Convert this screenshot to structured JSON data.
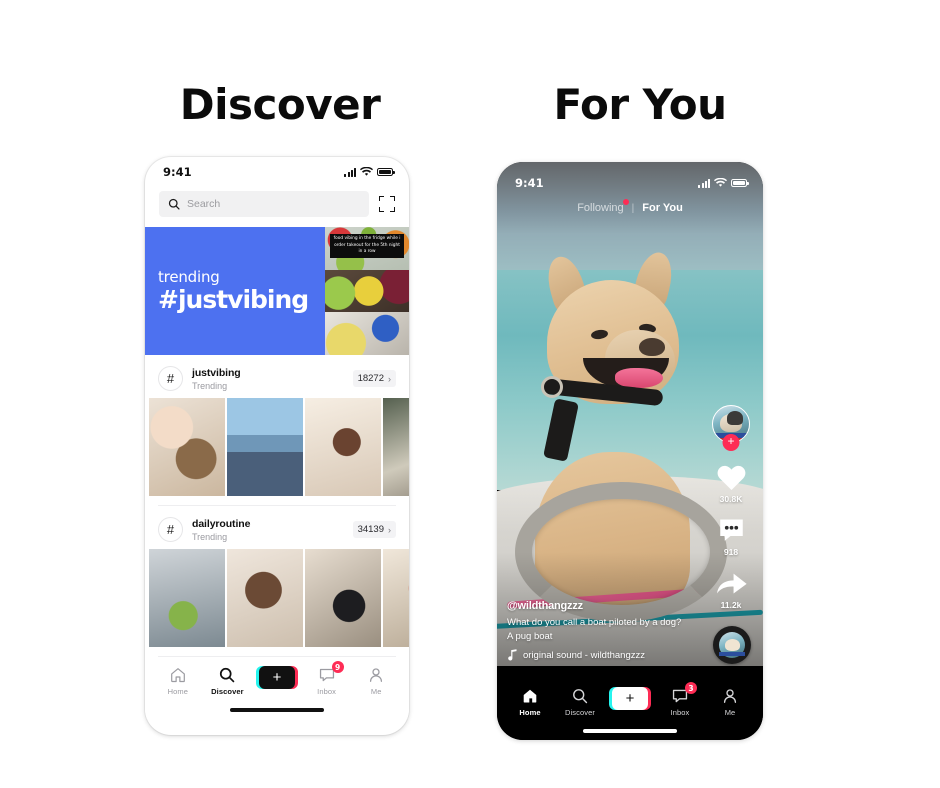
{
  "page": {
    "headings": {
      "left": "Discover",
      "right": "For You"
    }
  },
  "colors": {
    "accent_pink": "#fe2c55",
    "accent_cyan": "#25f4ee",
    "banner_blue": "#4d71f0",
    "badge_red": "#fe2c55"
  },
  "left_phone": {
    "status_bar": {
      "time": "9:41",
      "icons": [
        "signal-bars-icon",
        "wifi-icon",
        "battery-icon"
      ]
    },
    "search": {
      "placeholder": "Search",
      "icon": "search-icon",
      "scan_icon": "scan-code-icon"
    },
    "banner": {
      "label": "trending",
      "hashtag": "#justvibing",
      "thumbnail_caption": "food vibing in the fridge while i order takeout for the 5th night in a row"
    },
    "hashtags": [
      {
        "symbol": "#",
        "name": "justvibing",
        "subtitle": "Trending",
        "count": "18272",
        "chevron": "›"
      },
      {
        "symbol": "#",
        "name": "dailyroutine",
        "subtitle": "Trending",
        "count": "34139",
        "chevron": "›"
      }
    ],
    "nav": {
      "items": [
        {
          "label": "Home",
          "icon": "home-icon",
          "active": false,
          "badge": ""
        },
        {
          "label": "Discover",
          "icon": "search-icon",
          "active": true,
          "badge": ""
        },
        {
          "label": "",
          "icon": "create-plus-icon",
          "active": false,
          "badge": ""
        },
        {
          "label": "Inbox",
          "icon": "inbox-message-icon",
          "active": false,
          "badge": "9"
        },
        {
          "label": "Me",
          "icon": "person-icon",
          "active": false,
          "badge": ""
        }
      ],
      "plus_glyph": "+"
    }
  },
  "right_phone": {
    "status_bar": {
      "time": "9:41",
      "icons": [
        "signal-bars-icon",
        "wifi-icon",
        "battery-icon"
      ]
    },
    "feed_tabs": {
      "following": "Following",
      "separator": "|",
      "for_you": "For You",
      "active": "For You",
      "has_notification_dot": true
    },
    "video": {
      "handle": "@wildthangzzz",
      "caption_line1": "What do you call a boat piloted by a dog?",
      "caption_line2": "A pug boat",
      "sound_label": "original sound - wildthangzzz",
      "sound_icon": "music-note-icon"
    },
    "rail": {
      "avatar": {
        "name": "profile-avatar",
        "follow_glyph": "+"
      },
      "likes": {
        "icon": "heart-icon",
        "count": "30.8K"
      },
      "comments": {
        "icon": "comment-icon",
        "count": "918"
      },
      "shares": {
        "icon": "share-arrow-icon",
        "count": "11.2k"
      }
    },
    "nav": {
      "items": [
        {
          "label": "Home",
          "icon": "home-icon",
          "active": true,
          "badge": ""
        },
        {
          "label": "Discover",
          "icon": "search-icon",
          "active": false,
          "badge": ""
        },
        {
          "label": "",
          "icon": "create-plus-icon",
          "active": false,
          "badge": ""
        },
        {
          "label": "Inbox",
          "icon": "inbox-message-icon",
          "active": false,
          "badge": "3"
        },
        {
          "label": "Me",
          "icon": "person-icon",
          "active": false,
          "badge": ""
        }
      ],
      "plus_glyph": "+"
    }
  }
}
